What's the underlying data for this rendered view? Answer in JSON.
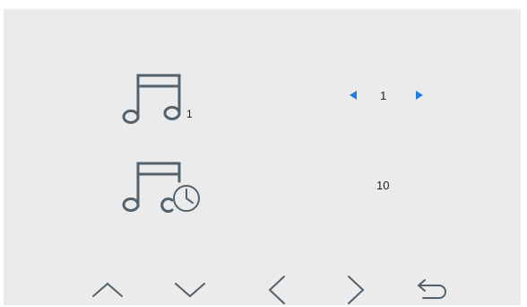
{
  "colors": {
    "background": "#ebebeb",
    "icon": "#52616b",
    "accent": "#1f7fe0",
    "text": "#222222"
  },
  "settings": [
    {
      "name": "ringtone",
      "icon": "music-note-icon",
      "icon_suffix": "1",
      "value": "1",
      "has_arrows": true
    },
    {
      "name": "ring-duration",
      "icon": "music-note-clock-icon",
      "value": "10",
      "has_arrows": false
    }
  ],
  "nav": [
    {
      "name": "nav-up-button",
      "icon": "chevron-up-icon"
    },
    {
      "name": "nav-down-button",
      "icon": "chevron-down-icon"
    },
    {
      "name": "nav-left-button",
      "icon": "chevron-left-icon"
    },
    {
      "name": "nav-right-button",
      "icon": "chevron-right-icon"
    },
    {
      "name": "back-button",
      "icon": "return-arrow-icon"
    }
  ]
}
